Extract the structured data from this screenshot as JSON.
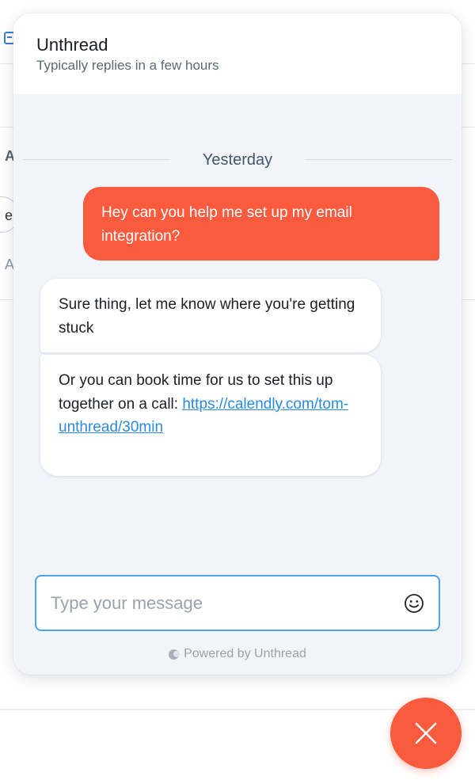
{
  "widget": {
    "header": {
      "title": "Unthread",
      "subtitle": "Typically replies in a few hours"
    },
    "date_divider": "Yesterday",
    "messages": [
      {
        "direction": "outgoing",
        "text": "Hey can you help me set up my email integration?"
      },
      {
        "direction": "incoming",
        "text": "Sure thing, let me know where you're getting stuck"
      },
      {
        "direction": "incoming",
        "text": "Or you can book time for us to set this up together on a call:",
        "link": "https://calendly.com/tom-unthread/30min"
      }
    ],
    "composer": {
      "placeholder": "Type your message",
      "value": "",
      "emoji_icon": "smiley-icon"
    },
    "footer": {
      "powered_by": "Powered by Unthread"
    }
  },
  "launcher": {
    "icon": "close-icon"
  },
  "background_page": {
    "fragments": [
      "A",
      "e",
      "A"
    ]
  },
  "colors": {
    "accent": "#fa5a3e",
    "widget_bg": "#f1f4f8",
    "link": "#2a8ae3",
    "input_focus": "#4aa4ef"
  }
}
